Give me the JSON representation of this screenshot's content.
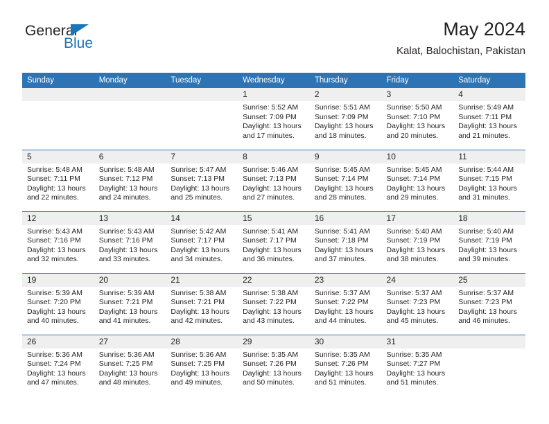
{
  "brand": {
    "name_top": "General",
    "name_bottom": "Blue",
    "triangle_color": "#1b75bb",
    "text_color": "#231f20"
  },
  "header": {
    "title": "May 2024",
    "subtitle": "Kalat, Balochistan, Pakistan"
  },
  "theme": {
    "header_blue": "#2e74b5",
    "daynum_band": "#efefef",
    "text": "#231f20",
    "background": "#ffffff"
  },
  "weekday_headers": [
    "Sunday",
    "Monday",
    "Tuesday",
    "Wednesday",
    "Thursday",
    "Friday",
    "Saturday"
  ],
  "weeks": [
    [
      {
        "day": "",
        "sunrise": "",
        "sunset": "",
        "daylight_1": "",
        "daylight_2": ""
      },
      {
        "day": "",
        "sunrise": "",
        "sunset": "",
        "daylight_1": "",
        "daylight_2": ""
      },
      {
        "day": "",
        "sunrise": "",
        "sunset": "",
        "daylight_1": "",
        "daylight_2": ""
      },
      {
        "day": "1",
        "sunrise": "Sunrise: 5:52 AM",
        "sunset": "Sunset: 7:09 PM",
        "daylight_1": "Daylight: 13 hours",
        "daylight_2": "and 17 minutes."
      },
      {
        "day": "2",
        "sunrise": "Sunrise: 5:51 AM",
        "sunset": "Sunset: 7:09 PM",
        "daylight_1": "Daylight: 13 hours",
        "daylight_2": "and 18 minutes."
      },
      {
        "day": "3",
        "sunrise": "Sunrise: 5:50 AM",
        "sunset": "Sunset: 7:10 PM",
        "daylight_1": "Daylight: 13 hours",
        "daylight_2": "and 20 minutes."
      },
      {
        "day": "4",
        "sunrise": "Sunrise: 5:49 AM",
        "sunset": "Sunset: 7:11 PM",
        "daylight_1": "Daylight: 13 hours",
        "daylight_2": "and 21 minutes."
      }
    ],
    [
      {
        "day": "5",
        "sunrise": "Sunrise: 5:48 AM",
        "sunset": "Sunset: 7:11 PM",
        "daylight_1": "Daylight: 13 hours",
        "daylight_2": "and 22 minutes."
      },
      {
        "day": "6",
        "sunrise": "Sunrise: 5:48 AM",
        "sunset": "Sunset: 7:12 PM",
        "daylight_1": "Daylight: 13 hours",
        "daylight_2": "and 24 minutes."
      },
      {
        "day": "7",
        "sunrise": "Sunrise: 5:47 AM",
        "sunset": "Sunset: 7:13 PM",
        "daylight_1": "Daylight: 13 hours",
        "daylight_2": "and 25 minutes."
      },
      {
        "day": "8",
        "sunrise": "Sunrise: 5:46 AM",
        "sunset": "Sunset: 7:13 PM",
        "daylight_1": "Daylight: 13 hours",
        "daylight_2": "and 27 minutes."
      },
      {
        "day": "9",
        "sunrise": "Sunrise: 5:45 AM",
        "sunset": "Sunset: 7:14 PM",
        "daylight_1": "Daylight: 13 hours",
        "daylight_2": "and 28 minutes."
      },
      {
        "day": "10",
        "sunrise": "Sunrise: 5:45 AM",
        "sunset": "Sunset: 7:14 PM",
        "daylight_1": "Daylight: 13 hours",
        "daylight_2": "and 29 minutes."
      },
      {
        "day": "11",
        "sunrise": "Sunrise: 5:44 AM",
        "sunset": "Sunset: 7:15 PM",
        "daylight_1": "Daylight: 13 hours",
        "daylight_2": "and 31 minutes."
      }
    ],
    [
      {
        "day": "12",
        "sunrise": "Sunrise: 5:43 AM",
        "sunset": "Sunset: 7:16 PM",
        "daylight_1": "Daylight: 13 hours",
        "daylight_2": "and 32 minutes."
      },
      {
        "day": "13",
        "sunrise": "Sunrise: 5:43 AM",
        "sunset": "Sunset: 7:16 PM",
        "daylight_1": "Daylight: 13 hours",
        "daylight_2": "and 33 minutes."
      },
      {
        "day": "14",
        "sunrise": "Sunrise: 5:42 AM",
        "sunset": "Sunset: 7:17 PM",
        "daylight_1": "Daylight: 13 hours",
        "daylight_2": "and 34 minutes."
      },
      {
        "day": "15",
        "sunrise": "Sunrise: 5:41 AM",
        "sunset": "Sunset: 7:17 PM",
        "daylight_1": "Daylight: 13 hours",
        "daylight_2": "and 36 minutes."
      },
      {
        "day": "16",
        "sunrise": "Sunrise: 5:41 AM",
        "sunset": "Sunset: 7:18 PM",
        "daylight_1": "Daylight: 13 hours",
        "daylight_2": "and 37 minutes."
      },
      {
        "day": "17",
        "sunrise": "Sunrise: 5:40 AM",
        "sunset": "Sunset: 7:19 PM",
        "daylight_1": "Daylight: 13 hours",
        "daylight_2": "and 38 minutes."
      },
      {
        "day": "18",
        "sunrise": "Sunrise: 5:40 AM",
        "sunset": "Sunset: 7:19 PM",
        "daylight_1": "Daylight: 13 hours",
        "daylight_2": "and 39 minutes."
      }
    ],
    [
      {
        "day": "19",
        "sunrise": "Sunrise: 5:39 AM",
        "sunset": "Sunset: 7:20 PM",
        "daylight_1": "Daylight: 13 hours",
        "daylight_2": "and 40 minutes."
      },
      {
        "day": "20",
        "sunrise": "Sunrise: 5:39 AM",
        "sunset": "Sunset: 7:21 PM",
        "daylight_1": "Daylight: 13 hours",
        "daylight_2": "and 41 minutes."
      },
      {
        "day": "21",
        "sunrise": "Sunrise: 5:38 AM",
        "sunset": "Sunset: 7:21 PM",
        "daylight_1": "Daylight: 13 hours",
        "daylight_2": "and 42 minutes."
      },
      {
        "day": "22",
        "sunrise": "Sunrise: 5:38 AM",
        "sunset": "Sunset: 7:22 PM",
        "daylight_1": "Daylight: 13 hours",
        "daylight_2": "and 43 minutes."
      },
      {
        "day": "23",
        "sunrise": "Sunrise: 5:37 AM",
        "sunset": "Sunset: 7:22 PM",
        "daylight_1": "Daylight: 13 hours",
        "daylight_2": "and 44 minutes."
      },
      {
        "day": "24",
        "sunrise": "Sunrise: 5:37 AM",
        "sunset": "Sunset: 7:23 PM",
        "daylight_1": "Daylight: 13 hours",
        "daylight_2": "and 45 minutes."
      },
      {
        "day": "25",
        "sunrise": "Sunrise: 5:37 AM",
        "sunset": "Sunset: 7:23 PM",
        "daylight_1": "Daylight: 13 hours",
        "daylight_2": "and 46 minutes."
      }
    ],
    [
      {
        "day": "26",
        "sunrise": "Sunrise: 5:36 AM",
        "sunset": "Sunset: 7:24 PM",
        "daylight_1": "Daylight: 13 hours",
        "daylight_2": "and 47 minutes."
      },
      {
        "day": "27",
        "sunrise": "Sunrise: 5:36 AM",
        "sunset": "Sunset: 7:25 PM",
        "daylight_1": "Daylight: 13 hours",
        "daylight_2": "and 48 minutes."
      },
      {
        "day": "28",
        "sunrise": "Sunrise: 5:36 AM",
        "sunset": "Sunset: 7:25 PM",
        "daylight_1": "Daylight: 13 hours",
        "daylight_2": "and 49 minutes."
      },
      {
        "day": "29",
        "sunrise": "Sunrise: 5:35 AM",
        "sunset": "Sunset: 7:26 PM",
        "daylight_1": "Daylight: 13 hours",
        "daylight_2": "and 50 minutes."
      },
      {
        "day": "30",
        "sunrise": "Sunrise: 5:35 AM",
        "sunset": "Sunset: 7:26 PM",
        "daylight_1": "Daylight: 13 hours",
        "daylight_2": "and 51 minutes."
      },
      {
        "day": "31",
        "sunrise": "Sunrise: 5:35 AM",
        "sunset": "Sunset: 7:27 PM",
        "daylight_1": "Daylight: 13 hours",
        "daylight_2": "and 51 minutes."
      },
      {
        "day": "",
        "sunrise": "",
        "sunset": "",
        "daylight_1": "",
        "daylight_2": ""
      }
    ]
  ]
}
